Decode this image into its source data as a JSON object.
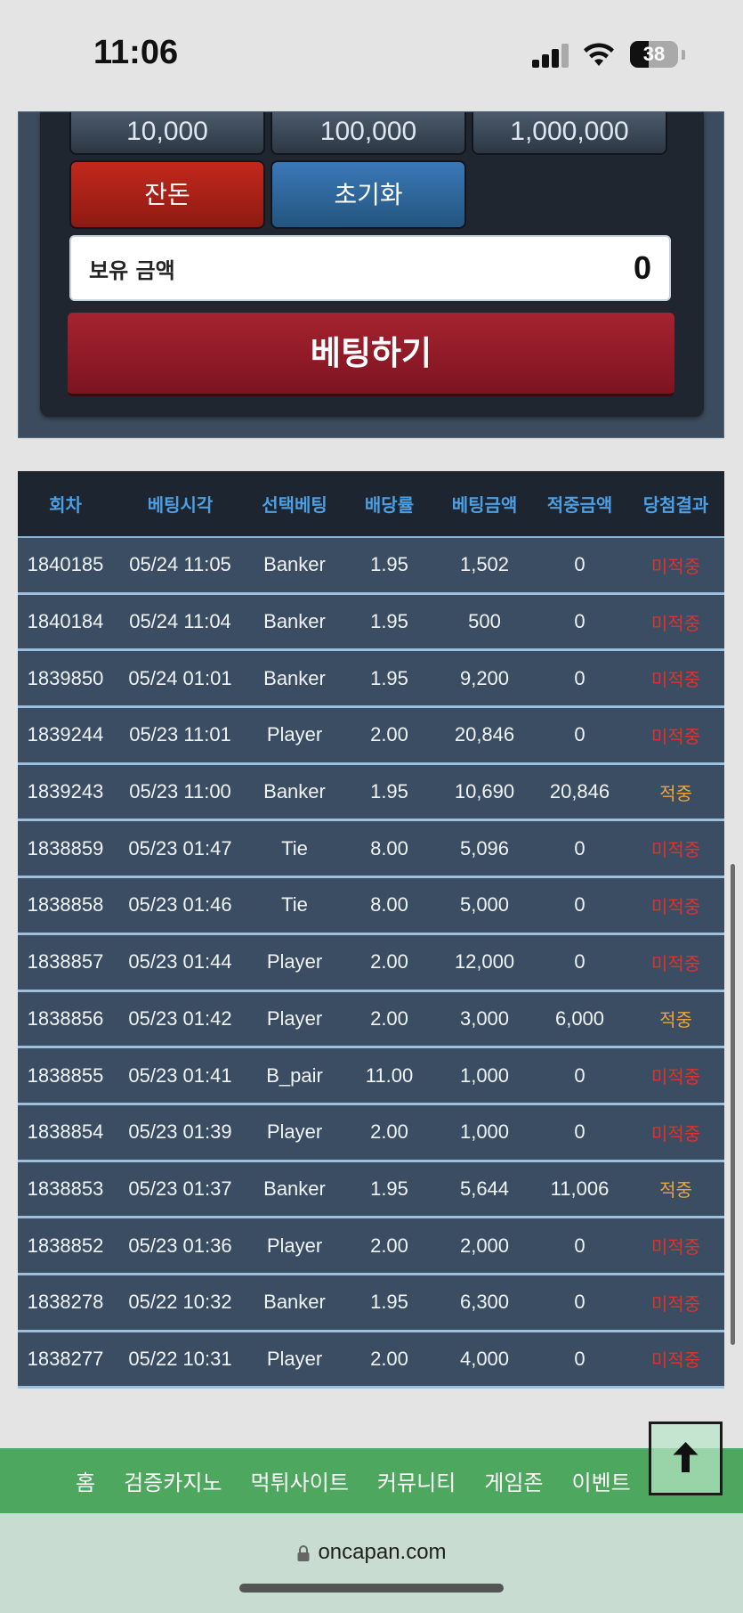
{
  "status": {
    "time": "11:06",
    "battery": "38",
    "battery_level": 0.38
  },
  "panel": {
    "amounts": [
      "10,000",
      "100,000",
      "1,000,000"
    ],
    "change_label": "잔돈",
    "reset_label": "초기화",
    "holding_label": "보유 금액",
    "holding_value": "0",
    "bet_label": "베팅하기"
  },
  "history": {
    "headers": [
      "회차",
      "베팅시각",
      "선택베팅",
      "배당률",
      "베팅금액",
      "적중금액",
      "당첨결과"
    ],
    "rows": [
      [
        "1840185",
        "05/24 11:05",
        "Banker",
        "1.95",
        "1,502",
        "0",
        "미적중"
      ],
      [
        "1840184",
        "05/24 11:04",
        "Banker",
        "1.95",
        "500",
        "0",
        "미적중"
      ],
      [
        "1839850",
        "05/24 01:01",
        "Banker",
        "1.95",
        "9,200",
        "0",
        "미적중"
      ],
      [
        "1839244",
        "05/23 11:01",
        "Player",
        "2.00",
        "20,846",
        "0",
        "미적중"
      ],
      [
        "1839243",
        "05/23 11:00",
        "Banker",
        "1.95",
        "10,690",
        "20,846",
        "적중"
      ],
      [
        "1838859",
        "05/23 01:47",
        "Tie",
        "8.00",
        "5,096",
        "0",
        "미적중"
      ],
      [
        "1838858",
        "05/23 01:46",
        "Tie",
        "8.00",
        "5,000",
        "0",
        "미적중"
      ],
      [
        "1838857",
        "05/23 01:44",
        "Player",
        "2.00",
        "12,000",
        "0",
        "미적중"
      ],
      [
        "1838856",
        "05/23 01:42",
        "Player",
        "2.00",
        "3,000",
        "6,000",
        "적중"
      ],
      [
        "1838855",
        "05/23 01:41",
        "B_pair",
        "11.00",
        "1,000",
        "0",
        "미적중"
      ],
      [
        "1838854",
        "05/23 01:39",
        "Player",
        "2.00",
        "1,000",
        "0",
        "미적중"
      ],
      [
        "1838853",
        "05/23 01:37",
        "Banker",
        "1.95",
        "5,644",
        "11,006",
        "적중"
      ],
      [
        "1838852",
        "05/23 01:36",
        "Player",
        "2.00",
        "2,000",
        "0",
        "미적중"
      ],
      [
        "1838278",
        "05/22 10:32",
        "Banker",
        "1.95",
        "6,300",
        "0",
        "미적중"
      ],
      [
        "1838277",
        "05/22 10:31",
        "Player",
        "2.00",
        "4,000",
        "0",
        "미적중"
      ]
    ]
  },
  "nav": {
    "items": [
      "홈",
      "검증카지노",
      "먹튀사이트",
      "커뮤니티",
      "게임존",
      "이벤트"
    ]
  },
  "browser": {
    "url": "oncapan.com"
  },
  "colors": {
    "miss": "#e0322b",
    "hit": "#e9a63a",
    "header_text": "#4c9fe3",
    "nav_bg": "#4ea75e"
  },
  "icons": {
    "scroll_top": "arrow-up-icon",
    "lock": "lock-icon"
  }
}
